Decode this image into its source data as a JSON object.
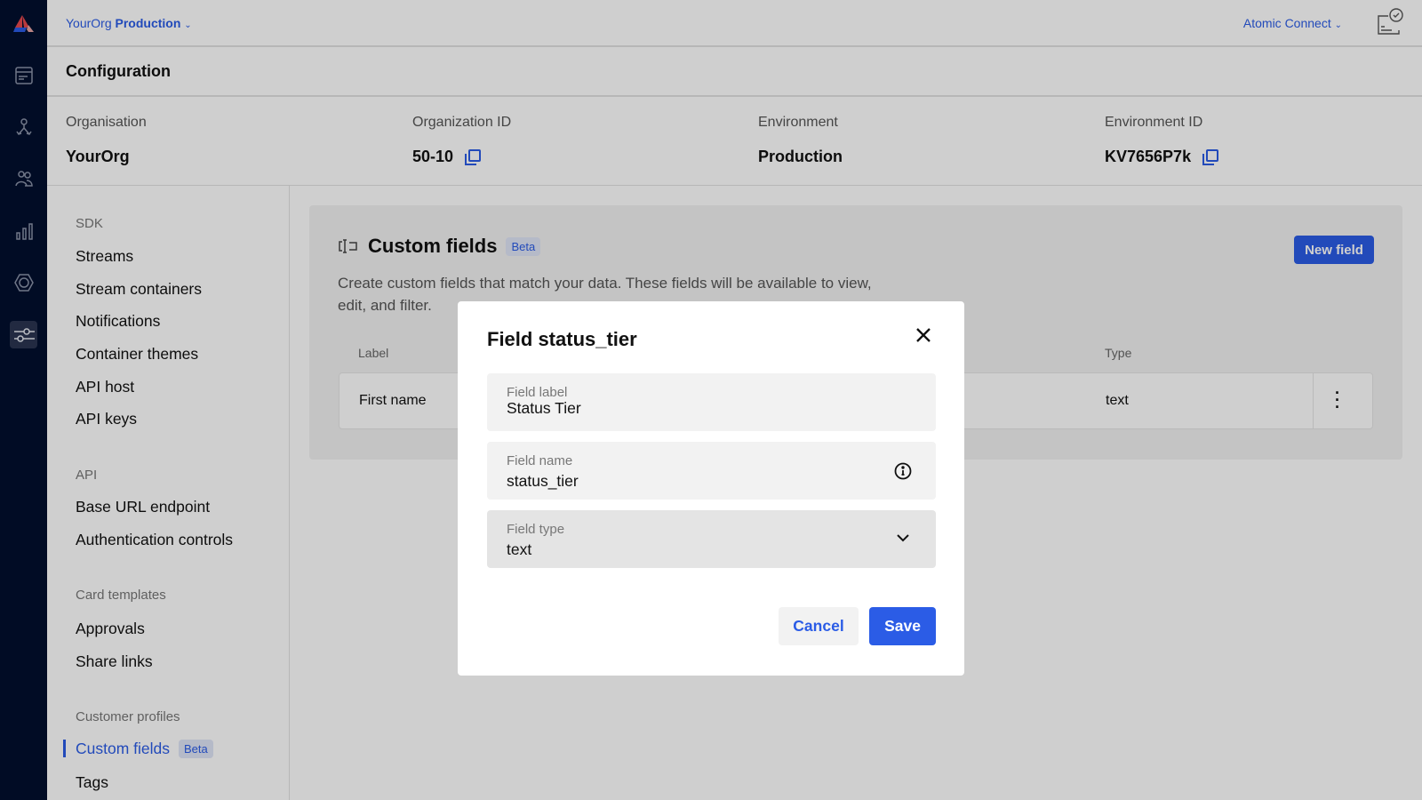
{
  "topbar": {
    "org": "YourOrg",
    "env": "Production",
    "app_switcher": "Atomic Connect"
  },
  "page": {
    "title": "Configuration"
  },
  "info": [
    {
      "label": "Organisation",
      "value": "YourOrg"
    },
    {
      "label": "Organization ID",
      "value": "50-10"
    },
    {
      "label": "Environment",
      "value": "Production"
    },
    {
      "label": "Environment ID",
      "value": "KV7656P7k"
    }
  ],
  "nav": {
    "sections": [
      {
        "title": "SDK",
        "items": [
          "Streams",
          "Stream containers",
          "Notifications",
          "Container themes",
          "API host",
          "API keys"
        ]
      },
      {
        "title": "API",
        "items": [
          "Base URL endpoint",
          "Authentication controls"
        ]
      },
      {
        "title": "Card templates",
        "items": [
          "Approvals",
          "Share links"
        ]
      },
      {
        "title": "Customer profiles",
        "items": [
          "Custom fields",
          "Tags"
        ]
      }
    ],
    "active": "Custom fields",
    "active_badge": "Beta"
  },
  "panel": {
    "title": "Custom fields",
    "badge": "Beta",
    "description_1": "Create custom fields that match your data. These fields will be available to view,",
    "description_2": "edit, and filter.",
    "new_button": "New field",
    "columns": {
      "label": "Label",
      "type": "Type"
    },
    "rows": [
      {
        "label": "First name",
        "type": "text"
      }
    ]
  },
  "modal": {
    "title": "Field status_tier",
    "field_label": {
      "label": "Field label",
      "value": "Status Tier"
    },
    "field_name": {
      "label": "Field name",
      "value": "status_tier"
    },
    "field_type": {
      "label": "Field type",
      "value": "text"
    },
    "cancel": "Cancel",
    "save": "Save"
  },
  "colors": {
    "accent": "#2b5ce6",
    "rail": "#020f2e"
  }
}
